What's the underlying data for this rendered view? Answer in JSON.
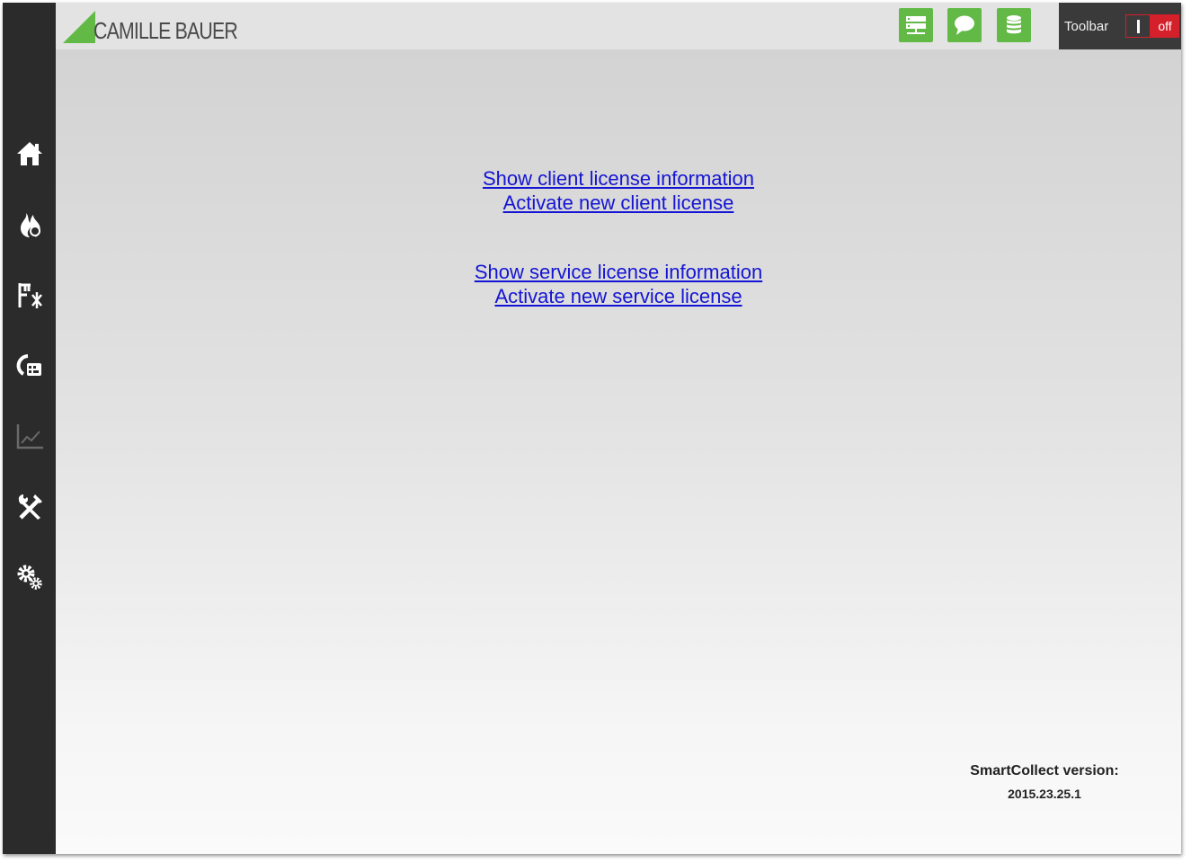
{
  "brand": {
    "name": "CAMILLE BAUER",
    "accent_color": "#62b946",
    "logo_icon": "green-triangle-logo"
  },
  "header": {
    "buttons": [
      {
        "name": "network-server-icon",
        "color": "#62b946"
      },
      {
        "name": "chat-bubble-icon",
        "color": "#62b946"
      },
      {
        "name": "database-icon",
        "color": "#62b946"
      }
    ],
    "toolbar": {
      "label": "Toolbar",
      "toggle_state": "off",
      "off_label": "off",
      "off_color": "#d3202a"
    }
  },
  "sidebar": {
    "items": [
      {
        "icon": "home-icon"
      },
      {
        "icon": "flame-meter-icon"
      },
      {
        "icon": "plant-structure-icon"
      },
      {
        "icon": "gauge-dashboard-icon"
      },
      {
        "icon": "line-chart-icon",
        "state": "disabled"
      },
      {
        "icon": "tools-icon"
      },
      {
        "icon": "settings-gears-icon"
      }
    ]
  },
  "main": {
    "client_links": {
      "show": "Show client license information",
      "activate": "Activate new client license"
    },
    "service_links": {
      "show": "Show service license information",
      "activate": "Activate new service license"
    },
    "version": {
      "label": "SmartCollect version:",
      "value": "2015.23.25.1"
    }
  }
}
